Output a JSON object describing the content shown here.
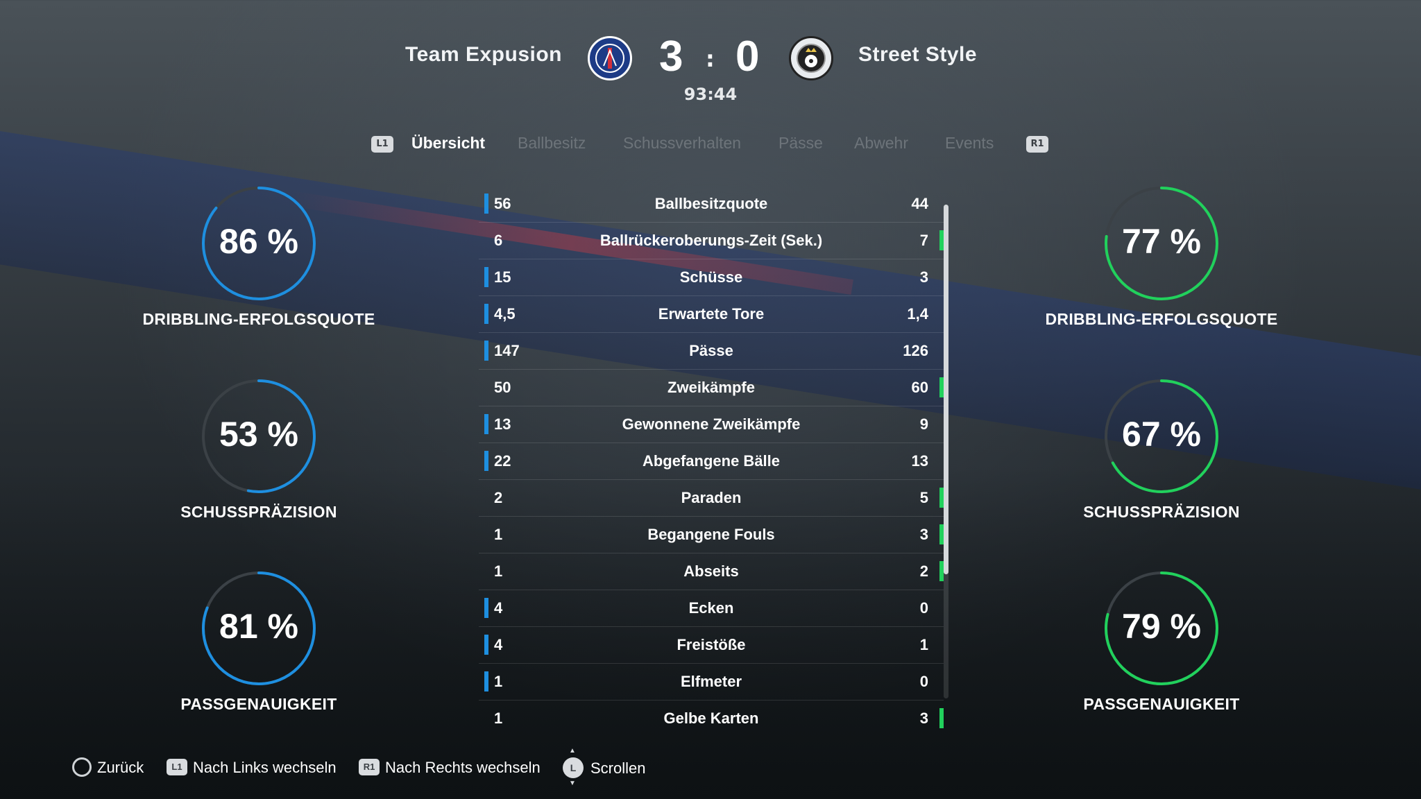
{
  "header": {
    "home_team": "Team Expusion",
    "away_team": "Street Style",
    "home_score": "3",
    "separator": ":",
    "away_score": "0",
    "match_time": "93:44"
  },
  "tabs": {
    "left_button": "L1",
    "right_button": "R1",
    "items": [
      "Übersicht",
      "Ballbesitz",
      "Schussverhalten",
      "Pässe",
      "Abwehr",
      "Events"
    ],
    "active": "Übersicht"
  },
  "stats": [
    {
      "home": "56",
      "label": "Ballbesitzquote",
      "away": "44",
      "leader": "home"
    },
    {
      "home": "6",
      "label": "Ballrückeroberungs-Zeit (Sek.)",
      "away": "7",
      "leader": "away"
    },
    {
      "home": "15",
      "label": "Schüsse",
      "away": "3",
      "leader": "home"
    },
    {
      "home": "4,5",
      "label": "Erwartete Tore",
      "away": "1,4",
      "leader": "home"
    },
    {
      "home": "147",
      "label": "Pässe",
      "away": "126",
      "leader": "home"
    },
    {
      "home": "50",
      "label": "Zweikämpfe",
      "away": "60",
      "leader": "away"
    },
    {
      "home": "13",
      "label": "Gewonnene Zweikämpfe",
      "away": "9",
      "leader": "home"
    },
    {
      "home": "22",
      "label": "Abgefangene Bälle",
      "away": "13",
      "leader": "home"
    },
    {
      "home": "2",
      "label": "Paraden",
      "away": "5",
      "leader": "away"
    },
    {
      "home": "1",
      "label": "Begangene Fouls",
      "away": "3",
      "leader": "away"
    },
    {
      "home": "1",
      "label": "Abseits",
      "away": "2",
      "leader": "away"
    },
    {
      "home": "4",
      "label": "Ecken",
      "away": "0",
      "leader": "home"
    },
    {
      "home": "4",
      "label": "Freistöße",
      "away": "1",
      "leader": "home"
    },
    {
      "home": "1",
      "label": "Elfmeter",
      "away": "0",
      "leader": "home"
    },
    {
      "home": "1",
      "label": "Gelbe Karten",
      "away": "3",
      "leader": "away"
    }
  ],
  "home_rings": [
    {
      "value": "86 %",
      "percent": 86,
      "label": "DRIBBLING-ERFOLGSQUOTE"
    },
    {
      "value": "53 %",
      "percent": 53,
      "label": "SCHUSSPRÄZISION"
    },
    {
      "value": "81 %",
      "percent": 81,
      "label": "PASSGENAUIGKEIT"
    }
  ],
  "away_rings": [
    {
      "value": "77 %",
      "percent": 77,
      "label": "DRIBBLING-ERFOLGSQUOTE"
    },
    {
      "value": "67 %",
      "percent": 67,
      "label": "SCHUSSPRÄZISION"
    },
    {
      "value": "79 %",
      "percent": 79,
      "label": "PASSGENAUIGKEIT"
    }
  ],
  "colors": {
    "home_accent": "#1e8fe0",
    "away_accent": "#21d15c",
    "ring_track": "#3b4146"
  },
  "footer": {
    "back_label": "Zurück",
    "left_label": "Nach Links wechseln",
    "left_button": "L1",
    "right_label": "Nach Rechts wechseln",
    "right_button": "R1",
    "scroll_label": "Scrollen",
    "scroll_button": "L"
  }
}
